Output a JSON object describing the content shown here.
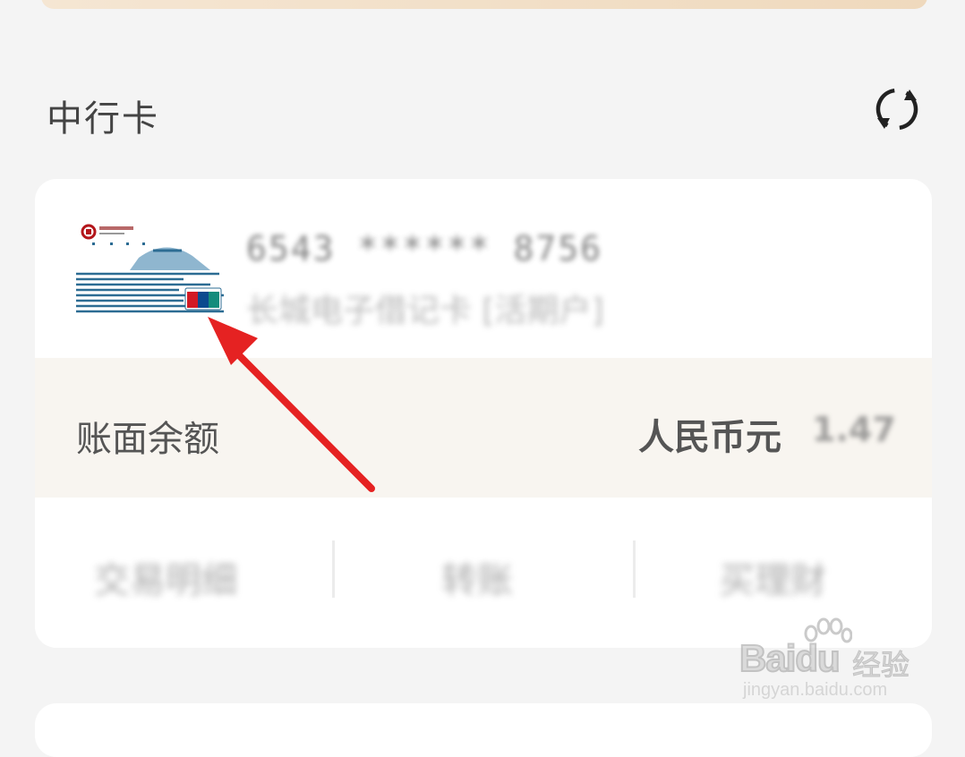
{
  "section": {
    "title": "中行卡",
    "refresh_icon": "refresh-icon"
  },
  "card": {
    "bank_logo_icon": "bank-of-china-card-icon",
    "number": "6543 ****** 8756",
    "description": "长城电子借记卡 [活期户]",
    "balance_label": "账面余额",
    "currency": "人民币元",
    "amount": "1.47",
    "actions": [
      "交易明细",
      "转账",
      "买理财"
    ]
  },
  "watermark": {
    "logo": "Baidu",
    "text": "经验",
    "url": "jingyan.baidu.com"
  },
  "colors": {
    "accent_arrow": "#e52222",
    "background": "#f4f4f4",
    "balance_bg": "#f8f5f0"
  }
}
